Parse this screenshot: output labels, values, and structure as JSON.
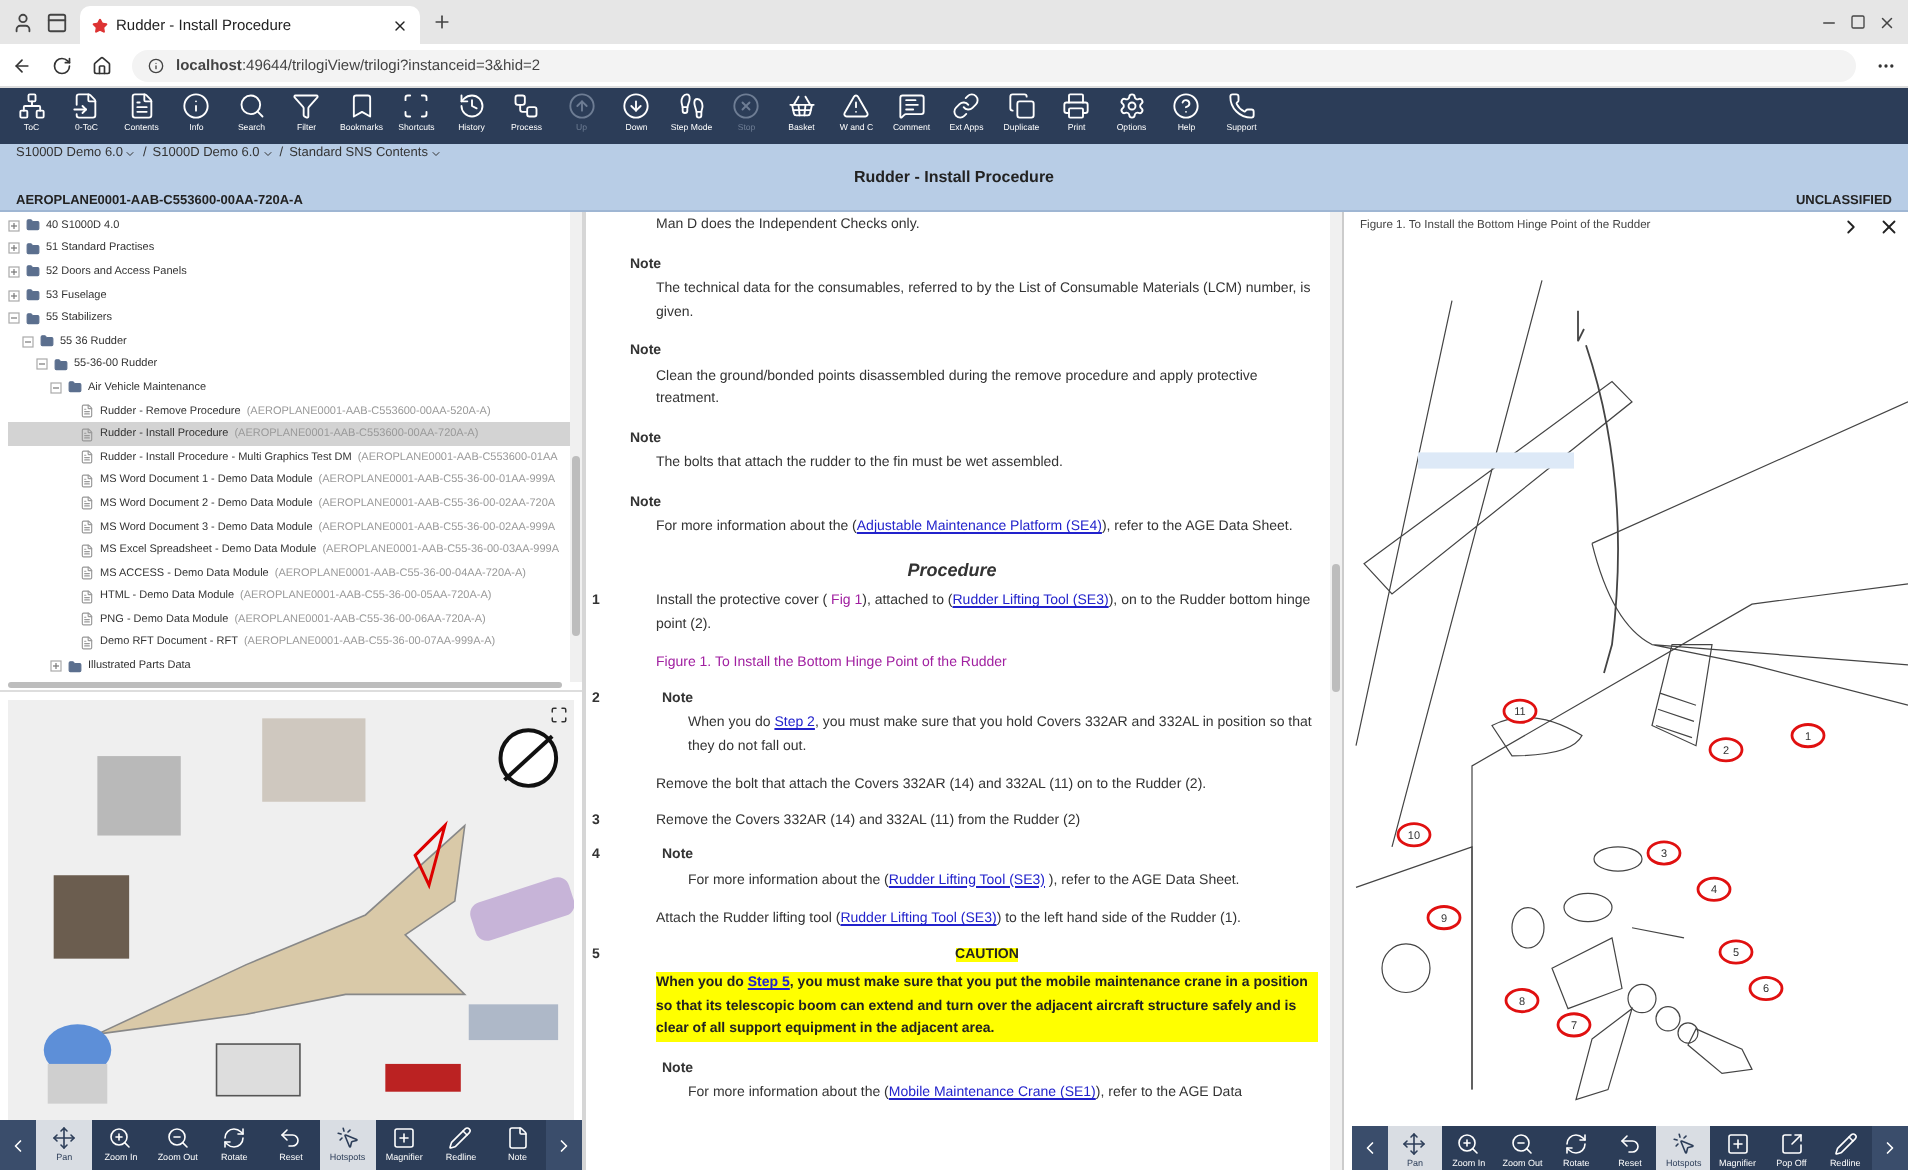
{
  "browser": {
    "tab_title": "Rudder - Install Procedure",
    "url": "**localhost**:49644/trilogiView/trilogi?instanceid=3&hid=2"
  },
  "toolbar": [
    {
      "kind": "toc",
      "label": "ToC",
      "disabled": false
    },
    {
      "kind": "dtoc",
      "label": "0-ToC",
      "disabled": false
    },
    {
      "kind": "contents",
      "label": "Contents",
      "disabled": false
    },
    {
      "kind": "info",
      "label": "Info",
      "disabled": false
    },
    {
      "kind": "search",
      "label": "Search",
      "disabled": false
    },
    {
      "kind": "filter",
      "label": "Filter",
      "disabled": false
    },
    {
      "kind": "bookmarks",
      "label": "Bookmarks",
      "disabled": false
    },
    {
      "kind": "shortcuts",
      "label": "Shortcuts",
      "disabled": false
    },
    {
      "kind": "history",
      "label": "History",
      "disabled": false
    },
    {
      "kind": "process",
      "label": "Process",
      "disabled": false
    },
    {
      "kind": "up",
      "label": "Up",
      "disabled": true
    },
    {
      "kind": "down",
      "label": "Down",
      "disabled": false
    },
    {
      "kind": "step",
      "label": "Step Mode",
      "disabled": false
    },
    {
      "kind": "stop",
      "label": "Stop",
      "disabled": true
    },
    {
      "kind": "basket",
      "label": "Basket",
      "disabled": false
    },
    {
      "kind": "warning",
      "label": "W and C",
      "disabled": false
    },
    {
      "kind": "comment",
      "label": "Comment",
      "disabled": false
    },
    {
      "kind": "link",
      "label": "Ext Apps",
      "disabled": false
    },
    {
      "kind": "duplicate",
      "label": "Duplicate",
      "disabled": false
    },
    {
      "kind": "print",
      "label": "Print",
      "disabled": false
    },
    {
      "kind": "options",
      "label": "Options",
      "disabled": false
    },
    {
      "kind": "help",
      "label": "Help",
      "disabled": false
    },
    {
      "kind": "support",
      "label": "Support",
      "disabled": false
    }
  ],
  "breadcrumbs": {
    "separator": "/",
    "items": [
      "S1000D Demo 6.0",
      "S1000D Demo 6.0",
      "Standard SNS Contents"
    ]
  },
  "title": "Rudder - Install Procedure",
  "document_code": "AEROPLANE0001-AAB-C553600-00AA-720A-A",
  "classification": "UNCLASSIFIED",
  "tree": [
    {
      "kind": "folder",
      "label": "40 S1000D 4.0",
      "expanded": false,
      "selected": false
    },
    {
      "kind": "folder",
      "label": "51 Standard Practises",
      "expanded": false,
      "selected": false
    },
    {
      "kind": "folder",
      "label": "52 Doors and Access Panels",
      "expanded": false,
      "selected": false
    },
    {
      "kind": "folder",
      "label": "53 Fuselage",
      "expanded": false,
      "selected": false
    },
    {
      "kind": "folder",
      "label": "55 Stabilizers",
      "expanded": true,
      "selected": false,
      "children": [
        {
          "kind": "folder",
          "label": "55 36 Rudder",
          "expanded": true,
          "selected": false,
          "children": [
            {
              "kind": "folder",
              "label": "55-36-00 Rudder",
              "expanded": true,
              "selected": false,
              "children": [
                {
                  "kind": "folder",
                  "label": "Air Vehicle Maintenance",
                  "expanded": true,
                  "selected": false,
                  "children": [
                    {
                      "kind": "document",
                      "label": "Rudder - Remove Procedure",
                      "code": "(AEROPLANE0001-AAB-C553600-00AA-520A-A)",
                      "selected": false
                    },
                    {
                      "kind": "document",
                      "label": "Rudder - Install Procedure",
                      "code": "(AEROPLANE0001-AAB-C553600-00AA-720A-A)",
                      "selected": true
                    },
                    {
                      "kind": "document",
                      "label": "Rudder - Install Procedure - Multi Graphics Test DM",
                      "code": "(AEROPLANE0001-AAB-C553600-01AA",
                      "selected": false
                    },
                    {
                      "kind": "document",
                      "label": "MS Word Document 1 - Demo Data Module",
                      "code": "(AEROPLANE0001-AAB-C55-36-00-01AA-999A",
                      "selected": false
                    },
                    {
                      "kind": "document",
                      "label": "MS Word Document 2 - Demo Data Module",
                      "code": "(AEROPLANE0001-AAB-C55-36-00-02AA-720A",
                      "selected": false
                    },
                    {
                      "kind": "document",
                      "label": "MS Word Document 3 - Demo Data Module",
                      "code": "(AEROPLANE0001-AAB-C55-36-00-02AA-999A",
                      "selected": false
                    },
                    {
                      "kind": "document",
                      "label": "MS Excel Spreadsheet - Demo Data Module",
                      "code": "(AEROPLANE0001-AAB-C55-36-00-03AA-999A",
                      "selected": false
                    },
                    {
                      "kind": "document",
                      "label": "MS ACCESS - Demo Data Module",
                      "code": "(AEROPLANE0001-AAB-C55-36-00-04AA-720A-A)",
                      "selected": false
                    },
                    {
                      "kind": "document",
                      "label": "HTML - Demo Data Module",
                      "code": "(AEROPLANE0001-AAB-C55-36-00-05AA-720A-A)",
                      "selected": false
                    },
                    {
                      "kind": "document",
                      "label": "PNG - Demo Data Module",
                      "code": "(AEROPLANE0001-AAB-C55-36-00-06AA-720A-A)",
                      "selected": false
                    },
                    {
                      "kind": "document",
                      "label": "Demo RFT Document - RFT",
                      "code": "(AEROPLANE0001-AAB-C55-36-00-07AA-999A-A)",
                      "selected": false
                    }
                  ]
                },
                {
                  "kind": "folder",
                  "label": "Illustrated Parts Data",
                  "expanded": false,
                  "selected": false
                }
              ]
            }
          ]
        }
      ]
    }
  ],
  "collage_toolbar": [
    {
      "kind": "pan",
      "label": "Pan",
      "selected": true
    },
    {
      "kind": "zoomin",
      "label": "Zoom In",
      "selected": false
    },
    {
      "kind": "zoomout",
      "label": "Zoom Out",
      "selected": false
    },
    {
      "kind": "rotate",
      "label": "Rotate",
      "selected": false
    },
    {
      "kind": "reset",
      "label": "Reset",
      "selected": false
    },
    {
      "kind": "hotspots",
      "label": "Hotspots",
      "selected": true
    },
    {
      "kind": "magnifier",
      "label": "Magnifier",
      "selected": false
    },
    {
      "kind": "redline",
      "label": "Redline",
      "selected": false
    },
    {
      "kind": "note",
      "label": "Note",
      "selected": false
    }
  ],
  "content": [
    {
      "kind": "para",
      "parts": [
        {
          "kind": "plain",
          "text": "Man D does the Independent Checks only."
        }
      ]
    },
    {
      "kind": "note",
      "title": "Note",
      "parts": [
        {
          "kind": "plain",
          "text": "The technical data for the consumables, referred to by the List of Consumable Materials (LCM) number, is given."
        }
      ]
    },
    {
      "kind": "note",
      "title": "Note",
      "parts": [
        {
          "kind": "plain",
          "text": "Clean the ground/bonded points disassembled during the remove procedure and apply protective treatment."
        }
      ]
    },
    {
      "kind": "note",
      "title": "Note",
      "parts": [
        {
          "kind": "plain",
          "text": "The bolts that attach the rudder to the fin must be wet assembled."
        }
      ]
    },
    {
      "kind": "note",
      "title": "Note",
      "parts": [
        {
          "kind": "plain",
          "text": "For more information about the ("
        },
        {
          "kind": "link",
          "text": "Adjustable Maintenance Platform (SE4)"
        },
        {
          "kind": "plain",
          "text": "), refer to the AGE Data Sheet."
        }
      ]
    },
    {
      "kind": "heading",
      "text": "Procedure"
    },
    {
      "kind": "step",
      "number": "1",
      "children": [
        {
          "kind": "para",
          "parts": [
            {
              "kind": "plain",
              "text": "Install the protective cover ( "
            },
            {
              "kind": "figure_link",
              "text": "Fig 1"
            },
            {
              "kind": "plain",
              "text": "), attached to ("
            },
            {
              "kind": "link",
              "text": "Rudder Lifting Tool (SE3)"
            },
            {
              "kind": "plain",
              "text": "), on to the Rudder bottom hinge point (2)."
            }
          ]
        },
        {
          "kind": "caption",
          "text": "Figure 1. To Install the Bottom Hinge Point of the Rudder"
        }
      ]
    },
    {
      "kind": "step",
      "number": "2",
      "children": [
        {
          "kind": "note",
          "title": "Note",
          "parts": [
            {
              "kind": "plain",
              "text": "When you do "
            },
            {
              "kind": "link",
              "text": "Step 2"
            },
            {
              "kind": "plain",
              "text": ", you must make sure that you hold Covers 332AR and 332AL in position so that they do not fall out."
            }
          ]
        },
        {
          "kind": "para",
          "parts": [
            {
              "kind": "plain",
              "text": "Remove the bolt that attach the Covers 332AR (14) and 332AL (11) on to the Rudder (2)."
            }
          ]
        }
      ]
    },
    {
      "kind": "step",
      "number": "3",
      "children": [
        {
          "kind": "para",
          "parts": [
            {
              "kind": "plain",
              "text": "Remove the Covers 332AR (14) and 332AL (11) from the Rudder (2)"
            }
          ]
        }
      ]
    },
    {
      "kind": "step",
      "number": "4",
      "children": [
        {
          "kind": "note",
          "title": "Note",
          "parts": [
            {
              "kind": "plain",
              "text": "For more information about the ("
            },
            {
              "kind": "link",
              "text": "Rudder Lifting Tool (SE3)"
            },
            {
              "kind": "plain",
              "text": " ), refer to the AGE Data Sheet."
            }
          ]
        },
        {
          "kind": "para",
          "parts": [
            {
              "kind": "plain",
              "text": "Attach the Rudder lifting tool ("
            },
            {
              "kind": "link",
              "text": "Rudder Lifting Tool (SE3)"
            },
            {
              "kind": "plain",
              "text": ") to the left hand side of the Rudder (1)."
            }
          ]
        }
      ]
    },
    {
      "kind": "step",
      "number": "5",
      "children": [
        {
          "kind": "caution",
          "title": "CAUTION",
          "parts": [
            {
              "kind": "plain",
              "text": "When you do "
            },
            {
              "kind": "link",
              "text": "Step 5"
            },
            {
              "kind": "plain",
              "text": ", you must make sure that you put the mobile maintenance crane in a position so that its telescopic boom can extend and turn over the adjacent aircraft structure safely and is clear of all support equipment in the adjacent area."
            }
          ]
        },
        {
          "kind": "note",
          "title": "Note",
          "parts": [
            {
              "kind": "plain",
              "text": "For more information about the ("
            },
            {
              "kind": "link",
              "text": "Mobile Maintenance Crane (SE1)"
            },
            {
              "kind": "plain",
              "text": "), refer to the AGE Data"
            }
          ]
        }
      ]
    }
  ],
  "figure": {
    "title": "Figure 1. To Install the Bottom Hinge Point of the Rudder",
    "callouts": [
      "11",
      "2",
      "1",
      "10",
      "3",
      "4",
      "9",
      "5",
      "6",
      "8",
      "7"
    ]
  },
  "figure_toolbar": [
    {
      "kind": "pan",
      "label": "Pan",
      "selected": true
    },
    {
      "kind": "zoomin",
      "label": "Zoom In",
      "selected": false
    },
    {
      "kind": "zoomout",
      "label": "Zoom Out",
      "selected": false
    },
    {
      "kind": "rotate",
      "label": "Rotate",
      "selected": false
    },
    {
      "kind": "reset",
      "label": "Reset",
      "selected": false
    },
    {
      "kind": "hotspots",
      "label": "Hotspots",
      "selected": true
    },
    {
      "kind": "magnifier",
      "label": "Magnifier",
      "selected": false
    },
    {
      "kind": "popoff",
      "label": "Pop Off",
      "selected": false
    },
    {
      "kind": "redline",
      "label": "Redline",
      "selected": false
    }
  ]
}
